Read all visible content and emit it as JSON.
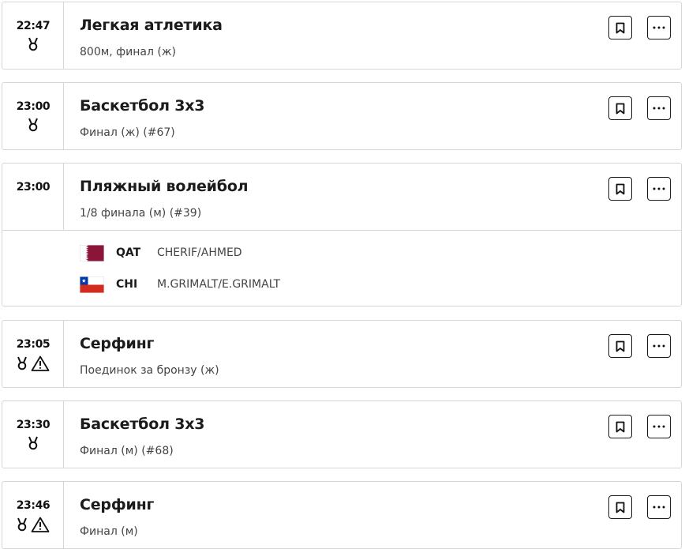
{
  "events": [
    {
      "time": "22:47",
      "medal": true,
      "alert": false,
      "title": "Легкая атлетика",
      "subtitle": "800м, финал (ж)"
    },
    {
      "time": "23:00",
      "medal": true,
      "alert": false,
      "title": "Баскетбол 3х3",
      "subtitle": "Финал (ж) (#67)"
    },
    {
      "time": "23:00",
      "medal": false,
      "alert": false,
      "title": "Пляжный волейбол",
      "subtitle": "1/8 финала (м) (#39)",
      "competitors": [
        {
          "code": "QAT",
          "names": "CHERIF/AHMED",
          "flag": "qatar-flag"
        },
        {
          "code": "CHI",
          "names": "M.GRIMALT/E.GRIMALT",
          "flag": "chile-flag"
        }
      ]
    },
    {
      "time": "23:05",
      "medal": true,
      "alert": true,
      "title": "Серфинг",
      "subtitle": "Поединок за бронзу (ж)"
    },
    {
      "time": "23:30",
      "medal": true,
      "alert": false,
      "title": "Баскетбол 3х3",
      "subtitle": "Финал (м) (#68)"
    },
    {
      "time": "23:46",
      "medal": true,
      "alert": true,
      "title": "Серфинг",
      "subtitle": "Финал (м)"
    }
  ],
  "icons": {
    "medal": "medal-icon",
    "alert": "warning-icon",
    "bookmark": "bookmark-icon",
    "more": "more-icon"
  },
  "colors": {
    "border": "#d6d6d6",
    "text": "#1b1b1b",
    "secondary": "#444444",
    "qatar": "#8a1538",
    "chile_red": "#d52b1e",
    "chile_blue": "#0039a6"
  }
}
